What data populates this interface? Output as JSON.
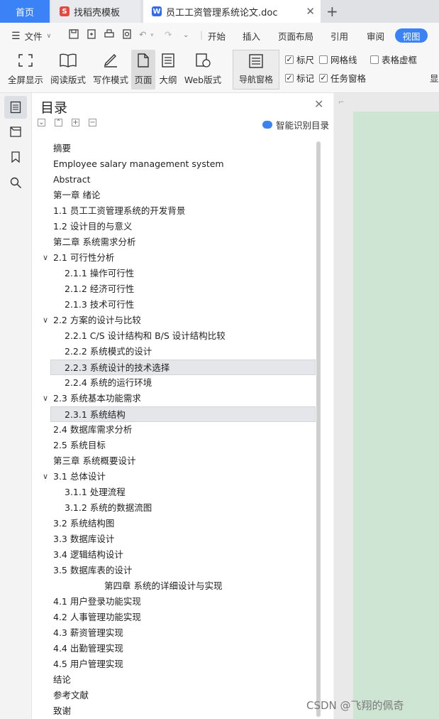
{
  "tabs": {
    "home": "首页",
    "template": "找稻壳模板",
    "document": "员工工资管理系统论文.doc"
  },
  "menu": {
    "file": "文件",
    "items": [
      "开始",
      "插入",
      "页面布局",
      "引用",
      "审阅"
    ],
    "active": "视图",
    "accent": "#3b82f6"
  },
  "ribbon": {
    "buttons": [
      "全屏显示",
      "阅读版式",
      "写作模式",
      "页面",
      "大纲",
      "Web版式"
    ],
    "nav_pane": "导航窗格",
    "checks": [
      {
        "label": "标尺",
        "checked": true
      },
      {
        "label": "网格线",
        "checked": false
      },
      {
        "label": "表格虚框",
        "checked": false
      },
      {
        "label": "标记",
        "checked": true
      },
      {
        "label": "任务窗格",
        "checked": true
      }
    ],
    "cut_label": "显"
  },
  "nav": {
    "title": "目录",
    "smart": "智能识别目录",
    "toc": [
      {
        "text": "摘要",
        "level": 1
      },
      {
        "text": "Employee salary management system",
        "level": 1
      },
      {
        "text": "Abstract",
        "level": 1
      },
      {
        "text": "第一章  绪论",
        "level": 1
      },
      {
        "text": "1.1  员工工资管理系统的开发背景",
        "level": 1
      },
      {
        "text": "1.2 设计目的与意义",
        "level": 1
      },
      {
        "text": "第二章  系统需求分析",
        "level": 1
      },
      {
        "text": "2.1  可行性分析",
        "level": 1,
        "expanded": true
      },
      {
        "text": "2.1.1  操作可行性",
        "level": 2
      },
      {
        "text": "2.1.2  经济可行性",
        "level": 2
      },
      {
        "text": "2.1.3  技术可行性",
        "level": 2
      },
      {
        "text": "2.2 方案的设计与比较",
        "level": 1,
        "expanded": true
      },
      {
        "text": "2.2.1 C/S 设计结构和 B/S 设计结构比较",
        "level": 2
      },
      {
        "text": "2.2.2  系统模式的设计",
        "level": 2
      },
      {
        "text": "2.2.3 系统设计的技术选择",
        "level": 2,
        "selected": true
      },
      {
        "text": "2.2.4 系统的运行环境",
        "level": 2
      },
      {
        "text": "2.3  系统基本功能需求",
        "level": 1,
        "expanded": true
      },
      {
        "text": "2.3.1  系统结构",
        "level": 2,
        "selected": true
      },
      {
        "text": "2.4  数据库需求分析",
        "level": 1
      },
      {
        "text": "2.5  系统目标",
        "level": 1
      },
      {
        "text": "第三章  系统概要设计",
        "level": 1
      },
      {
        "text": "3.1 总体设计",
        "level": 1,
        "expanded": true
      },
      {
        "text": "3.1.1  处理流程",
        "level": 2
      },
      {
        "text": "3.1.2 系统的数据流图",
        "level": 2
      },
      {
        "text": "3.2  系统结构图",
        "level": 1
      },
      {
        "text": "3.3 数据库设计",
        "level": 1
      },
      {
        "text": "3.4 逻辑结构设计",
        "level": 1
      },
      {
        "text": "3.5 数据库表的设计",
        "level": 1
      },
      {
        "text": "第四章  系统的详细设计与实现",
        "level": 3
      },
      {
        "text": "4.1  用户登录功能实现",
        "level": 1
      },
      {
        "text": "4.2  人事管理功能实现",
        "level": 1
      },
      {
        "text": "4.3  薪资管理实现",
        "level": 1
      },
      {
        "text": "4.4  出勤管理实现",
        "level": 1
      },
      {
        "text": "4.5  用户管理实现",
        "level": 1
      },
      {
        "text": "结论",
        "level": 1
      },
      {
        "text": "参考文献",
        "level": 1
      },
      {
        "text": "致谢",
        "level": 1
      }
    ]
  },
  "watermark": "CSDN @飞翔的佩奇"
}
